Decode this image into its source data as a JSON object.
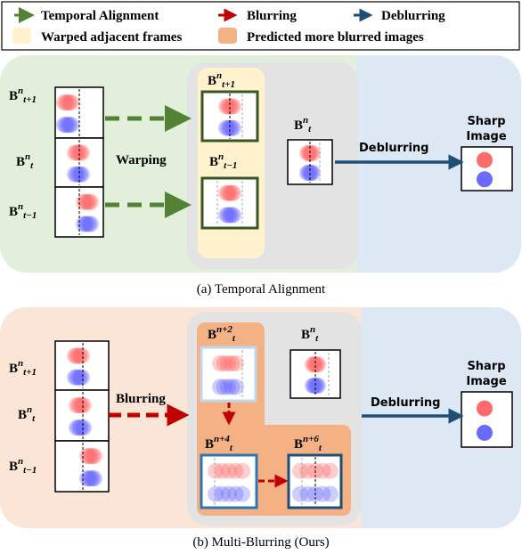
{
  "legend": {
    "temporal_alignment": "Temporal Alignment",
    "blurring": "Blurring",
    "deblurring": "Deblurring",
    "warped_frames": "Warped adjacent frames",
    "predicted_blurred": "Predicted more blurred images"
  },
  "colors": {
    "temporal_alignment_arrow": "#548235",
    "blurring_arrow": "#c00000",
    "deblurring_arrow": "#1f4e79",
    "warped_fill": "#fff2cc",
    "predicted_fill": "#f4b183",
    "panel_a_bg": "#e2efda",
    "panel_b_bg": "#fbe5d6",
    "center_bg": "#e6e6e6",
    "right_bg": "#dde8f4"
  },
  "panel_a": {
    "inputs": [
      {
        "base": "B",
        "sup": "n",
        "sub": "t+1"
      },
      {
        "base": "B",
        "sup": "n",
        "sub": "t"
      },
      {
        "base": "B",
        "sup": "n",
        "sub": "t−1"
      }
    ],
    "warping": "Warping",
    "warped": [
      {
        "base": "B",
        "sup": "n",
        "sub": "t+1"
      },
      {
        "base": "B",
        "sup": "n",
        "sub": "t−1"
      }
    ],
    "center": {
      "base": "B",
      "sup": "n",
      "sub": "t"
    },
    "deblurring": "Deblurring",
    "sharp_line1": "Sharp",
    "sharp_line2": "Image",
    "caption": "(a) Temporal Alignment"
  },
  "panel_b": {
    "inputs": [
      {
        "base": "B",
        "sup": "n",
        "sub": "t+1"
      },
      {
        "base": "B",
        "sup": "n",
        "sub": "t"
      },
      {
        "base": "B",
        "sup": "n",
        "sub": "t−1"
      }
    ],
    "blurring": "Blurring",
    "predicted": [
      {
        "base": "B",
        "sup": "n+2",
        "sub": "t"
      },
      {
        "base": "B",
        "sup": "n+4",
        "sub": "t"
      },
      {
        "base": "B",
        "sup": "n+6",
        "sub": "t"
      }
    ],
    "center": {
      "base": "B",
      "sup": "n",
      "sub": "t"
    },
    "deblurring": "Deblurring",
    "sharp_line1": "Sharp",
    "sharp_line2": "Image",
    "caption": "(b) Multi-Blurring (Ours)"
  }
}
